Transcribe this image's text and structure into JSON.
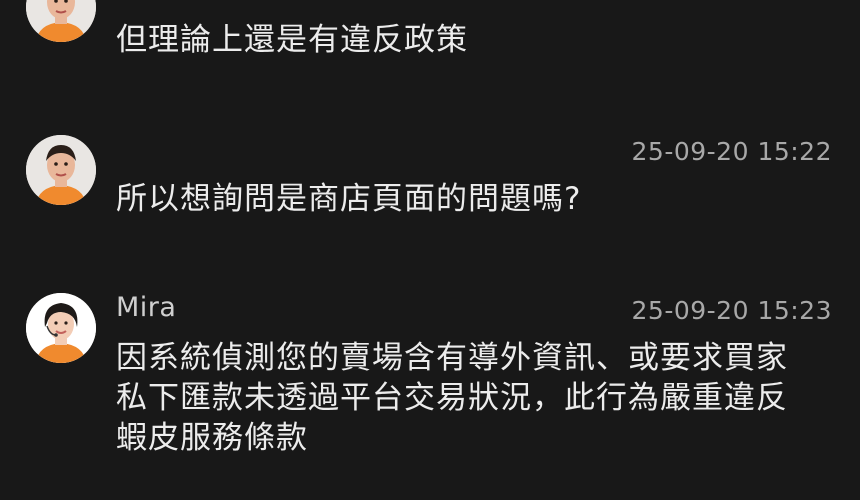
{
  "messages": [
    {
      "sender": "",
      "time": "",
      "text": "但理論上還是有違反政策",
      "avatar": "user-avatar"
    },
    {
      "sender": "",
      "time": "25-09-20 15:22",
      "text": "所以想詢問是商店頁面的問題嗎?",
      "avatar": "user-avatar"
    },
    {
      "sender": "Mira",
      "time": "25-09-20 15:23",
      "text": "因系統偵測您的賣場含有導外資訊、或要求買家\n私下匯款未透過平台交易狀況，此行為嚴重違反\n蝦皮服務條款",
      "avatar": "agent-avatar"
    }
  ]
}
